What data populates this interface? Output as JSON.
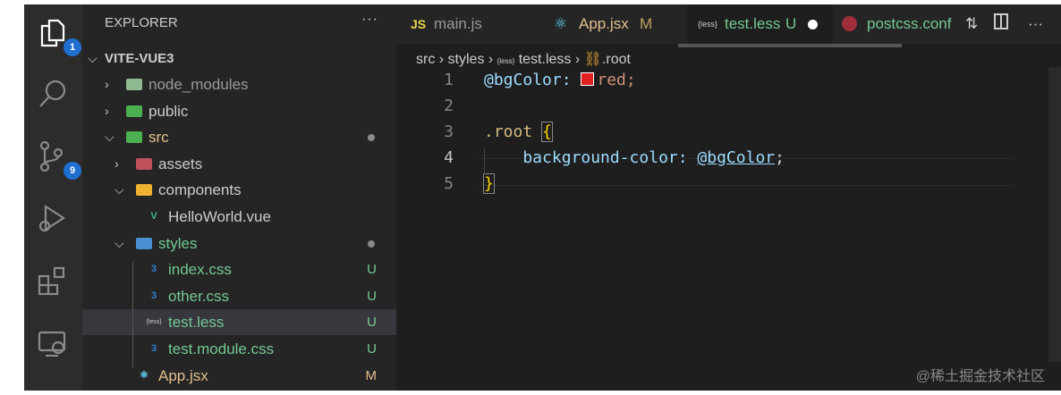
{
  "activity": {
    "explorer_badge": "1",
    "scm_badge": "9"
  },
  "sidebar": {
    "title": "EXPLORER",
    "more": "···",
    "root": "VITE-VUE3",
    "items": [
      {
        "name": "node_modules",
        "icon": "folder-node-icon",
        "status": ""
      },
      {
        "name": "public",
        "icon": "folder-public-icon",
        "status": ""
      },
      {
        "name": "src",
        "icon": "folder-src-icon",
        "status": "dot"
      },
      {
        "name": "assets",
        "icon": "folder-assets-icon",
        "status": ""
      },
      {
        "name": "components",
        "icon": "folder-components-icon",
        "status": ""
      },
      {
        "name": "HelloWorld.vue",
        "icon": "vue-icon",
        "status": ""
      },
      {
        "name": "styles",
        "icon": "folder-styles-icon",
        "status": "dot"
      },
      {
        "name": "index.css",
        "icon": "css-icon",
        "status": "U"
      },
      {
        "name": "other.css",
        "icon": "css-icon",
        "status": "U"
      },
      {
        "name": "test.less",
        "icon": "less-icon",
        "status": "U"
      },
      {
        "name": "test.module.css",
        "icon": "css-icon",
        "status": "U"
      },
      {
        "name": "App.jsx",
        "icon": "react-icon",
        "status": "M"
      }
    ]
  },
  "tabs": [
    {
      "label": "main.js",
      "icon_text": "JS",
      "status": ""
    },
    {
      "label": "App.jsx",
      "status": "M"
    },
    {
      "label": "test.less",
      "icon_text": "{less}",
      "status": "U"
    },
    {
      "label": "postcss.conf",
      "status": ""
    }
  ],
  "breadcrumb": {
    "a": "src",
    "b": "styles",
    "c": "test.less",
    "d": ".root",
    "less": "{less}"
  },
  "code": {
    "lines": [
      "1",
      "2",
      "3",
      "4",
      "5"
    ],
    "l1a": "@bgColor: ",
    "l1b": "red;",
    "l3a": ".root ",
    "l3b": "{",
    "l4a": "    background-color: ",
    "l4b": "@bgColor",
    "l4c": ";",
    "l5": "}"
  },
  "watermark": "@稀土掘金技术社区",
  "colors": {
    "swatch": "#e02020",
    "less_green": "#73c991",
    "modified": "#e2c08d"
  }
}
